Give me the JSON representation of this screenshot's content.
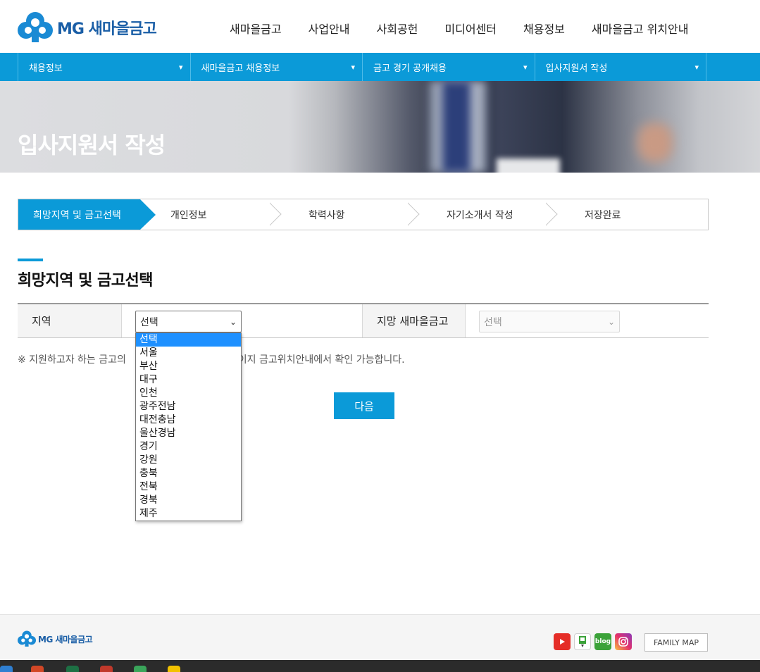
{
  "header": {
    "logo_text": "MG 새마을금고",
    "nav": [
      "새마을금고",
      "사업안내",
      "사회공헌",
      "미디어센터",
      "채용정보",
      "새마을금고 위치안내"
    ]
  },
  "subnav": {
    "items": [
      "채용정보",
      "새마을금고 채용정보",
      "금고 경기 공개채용",
      "입사지원서 작성"
    ]
  },
  "banner": {
    "title": "입사지원서 작성"
  },
  "steps": [
    "희망지역 및 금고선택",
    "개인정보",
    "학력사항",
    "자기소개서 작성",
    "저장완료"
  ],
  "section": {
    "title": "희망지역 및 금고선택"
  },
  "form": {
    "region_label": "지역",
    "region_selected": "선택",
    "branch_label": "지망 새마을금고",
    "branch_selected": "선택"
  },
  "notice": {
    "before": "※ 지원하고자 하는 금고의",
    "after": "이지 금고위치안내에서 확인 가능합니다."
  },
  "next_button": "다음",
  "dropdown": {
    "options": [
      "선택",
      "서울",
      "부산",
      "대구",
      "인천",
      "광주전남",
      "대전충남",
      "울산경남",
      "경기",
      "강원",
      "충북",
      "전북",
      "경북",
      "제주"
    ],
    "selected_index": 0
  },
  "footer": {
    "logo_text": "MG 새마을금고",
    "sns": [
      "youtube-icon",
      "naver-post-icon",
      "blog-icon",
      "instagram-icon"
    ],
    "blog_label": "blog",
    "family_map": "FAMILY MAP"
  },
  "colors": {
    "primary": "#0b9ad8",
    "brand": "#1a5ea6",
    "selected_option": "#1e90ff"
  }
}
